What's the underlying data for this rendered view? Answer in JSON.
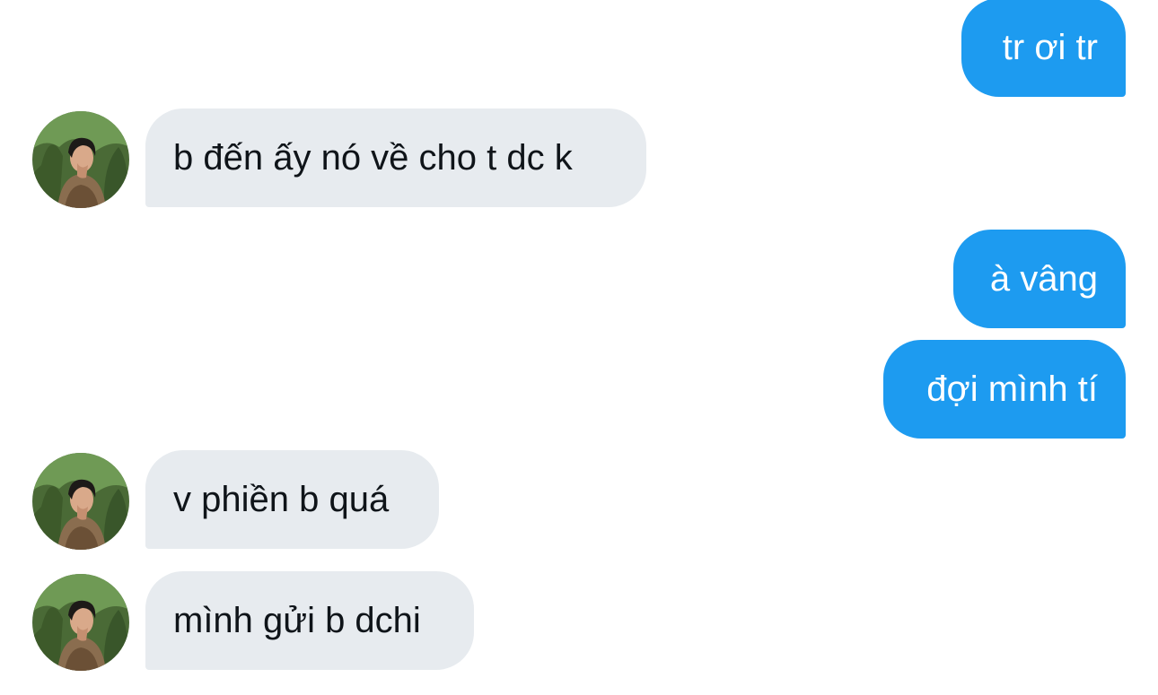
{
  "conversation": {
    "messages": [
      {
        "direction": "outgoing",
        "text": "tr ơi tr"
      },
      {
        "direction": "incoming",
        "text": "b đến ấy nó về cho t dc k",
        "has_avatar": true
      },
      {
        "direction": "outgoing",
        "text": "à vâng"
      },
      {
        "direction": "outgoing",
        "text": "đợi mình tí"
      },
      {
        "direction": "incoming",
        "text": "v phiền b quá",
        "has_avatar": true
      },
      {
        "direction": "incoming",
        "text": "mình gửi b dchi",
        "has_avatar": true
      }
    ]
  },
  "colors": {
    "outgoing_bubble": "#1d9bf0",
    "incoming_bubble": "#e7ebef",
    "outgoing_text": "#ffffff",
    "incoming_text": "#0f1419"
  },
  "icons": {
    "avatar": "user-avatar-photo"
  }
}
